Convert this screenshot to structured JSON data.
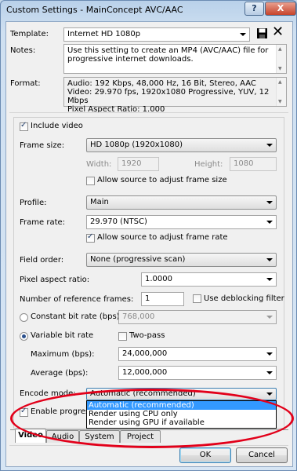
{
  "window": {
    "title": "Custom Settings - MainConcept AVC/AAC",
    "help_glyph": "?",
    "close_glyph": "X"
  },
  "template": {
    "label": "Template:",
    "value": "Internet HD 1080p",
    "save_icon": "floppy-disk-icon",
    "delete_glyph": "✕"
  },
  "notes": {
    "label": "Notes:",
    "text": "Use this setting to create an MP4 (AVC/AAC) file for progressive internet downloads."
  },
  "format": {
    "label": "Format:",
    "lines": [
      "Audio: 192 Kbps, 48,000 Hz, 16 Bit, Stereo, AAC",
      "Video: 29.970 fps, 1920x1080 Progressive, YUV, 12 Mbps",
      "Pixel Aspect Ratio: 1.000"
    ]
  },
  "video": {
    "include_video": "Include video",
    "frame_size_label": "Frame size:",
    "frame_size_value": "HD 1080p (1920x1080)",
    "width_label": "Width:",
    "width_value": "1920",
    "height_label": "Height:",
    "height_value": "1080",
    "allow_frame_size": "Allow source to adjust frame size",
    "profile_label": "Profile:",
    "profile_value": "Main",
    "frame_rate_label": "Frame rate:",
    "frame_rate_value": "29.970 (NTSC)",
    "allow_frame_rate": "Allow source to adjust frame rate",
    "field_order_label": "Field order:",
    "field_order_value": "None (progressive scan)",
    "pixel_aspect_label": "Pixel aspect ratio:",
    "pixel_aspect_value": "1.0000",
    "ref_frames_label": "Number of reference frames:",
    "ref_frames_value": "1",
    "deblocking_label": "Use deblocking filter",
    "cbr_label": "Constant bit rate (bps):",
    "cbr_value": "768,000",
    "vbr_label": "Variable bit rate",
    "two_pass_label": "Two-pass",
    "maximum_label": "Maximum (bps):",
    "maximum_value": "24,000,000",
    "average_label": "Average (bps):",
    "average_value": "12,000,000",
    "encode_mode_label": "Encode mode:",
    "encode_mode_value": "Automatic (recommended)",
    "encode_mode_options": [
      "Automatic (recommended)",
      "Render using CPU only",
      "Render using GPU if available"
    ],
    "enable_progressive_label": "Enable progressi"
  },
  "tabs": [
    "Video",
    "Audio",
    "System",
    "Project"
  ],
  "buttons": {
    "ok": "OK",
    "cancel": "Cancel"
  },
  "colors": {
    "highlight": "#3399ff",
    "annotation_red": "#e2001a",
    "close_button": "#c6432b"
  }
}
